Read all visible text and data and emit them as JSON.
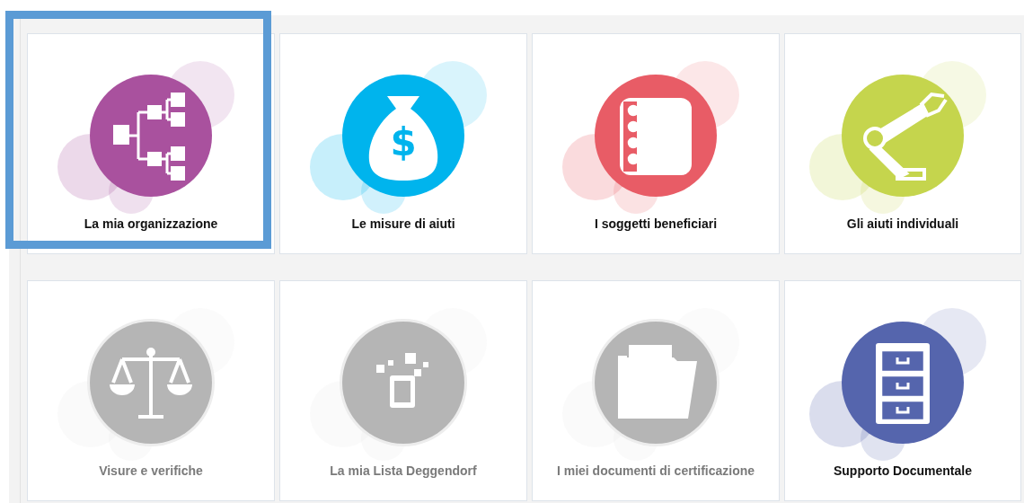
{
  "tiles": [
    {
      "label": "La mia organizzazione",
      "kind": "orgchart",
      "color": "#a9519e",
      "disabled": false,
      "highlighted": true
    },
    {
      "label": "Le misure di aiuti",
      "kind": "moneybag",
      "color": "#00b4ed",
      "disabled": false,
      "highlighted": false,
      "glyph": "$"
    },
    {
      "label": "I soggetti beneficiari",
      "kind": "addressbook",
      "color": "#e85c66",
      "disabled": false,
      "highlighted": false
    },
    {
      "label": "Gli aiuti individuali",
      "kind": "robotarm",
      "color": "#c5d54d",
      "disabled": false,
      "highlighted": false
    },
    {
      "label": "Visure e verifiche",
      "kind": "scales",
      "disabled": true,
      "highlighted": false
    },
    {
      "label": "La mia Lista Deggendorf",
      "kind": "tablet",
      "disabled": true,
      "highlighted": false
    },
    {
      "label": "I miei documenti di certificazione",
      "kind": "folder",
      "disabled": true,
      "highlighted": false
    },
    {
      "label": "Supporto Documentale",
      "kind": "cabinet",
      "color": "#5565ad",
      "disabled": false,
      "highlighted": false
    }
  ]
}
